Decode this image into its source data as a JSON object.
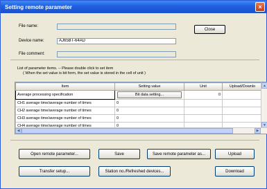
{
  "window": {
    "title": "Setting remote parameter",
    "close_glyph": "×"
  },
  "info": {
    "file_name_label": "File name:",
    "file_name_value": "",
    "device_name_label": "Device name:",
    "device_name_value": "AJ65BT-64AD",
    "file_comment_label": "File comment:",
    "file_comment_value": ""
  },
  "buttons": {
    "close": "Close",
    "open_remote_parameter": "Open remote parameter...",
    "save": "Save",
    "save_remote_parameter_as": "Save remote parameter as...",
    "upload": "Upload",
    "transfer_setup": "Transfer setup...",
    "station_refreshed": "Station no./Refreshed devices...",
    "download": "Download"
  },
  "notes": {
    "line1": "List of parameter items. -- Please double click to set item",
    "line2": "( When the set value is bit form, the set value is stored in the cell of unit )"
  },
  "table": {
    "columns": [
      "Item",
      "Setting value",
      "Unit",
      "Upload/Downlo"
    ],
    "rows": [
      {
        "item": "Average processing specification",
        "value": "Bit data setting...",
        "unit": "0",
        "updown": ""
      },
      {
        "item": "CH1 average time/average number of times",
        "value": "0",
        "unit": "",
        "updown": ""
      },
      {
        "item": "CH2 average time/average number of times",
        "value": "0",
        "unit": "",
        "updown": ""
      },
      {
        "item": "CH3 average time/average number of times",
        "value": "0",
        "unit": "",
        "updown": ""
      },
      {
        "item": "CH4 average time/average number of times",
        "value": "0",
        "unit": "",
        "updown": ""
      }
    ]
  },
  "scroll": {
    "up": "▲",
    "down": "▼",
    "left": "◀",
    "right": "▶"
  }
}
